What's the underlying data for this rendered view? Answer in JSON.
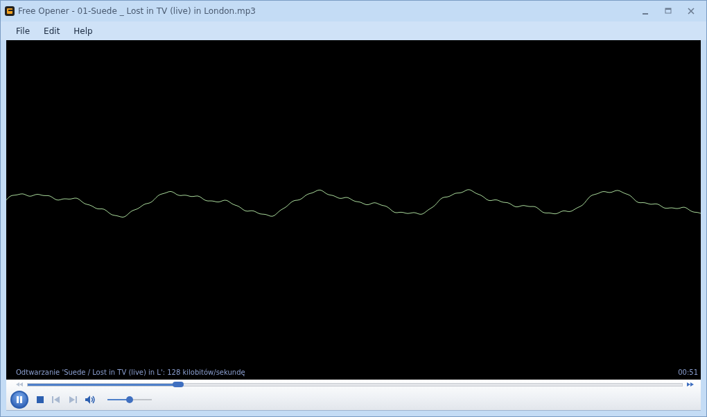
{
  "window": {
    "title": "Free Opener - 01-Suede _ Lost in TV (live) in London.mp3"
  },
  "menu": [
    "File",
    "Edit",
    "Help"
  ],
  "player": {
    "status": "Odtwarzanie 'Suede / Lost in TV (live) in L': 128 kilobitów/sekundę",
    "time": "00:51",
    "playing": true,
    "seek": {
      "level": 0.23
    },
    "volume": {
      "level": 0.5
    }
  }
}
